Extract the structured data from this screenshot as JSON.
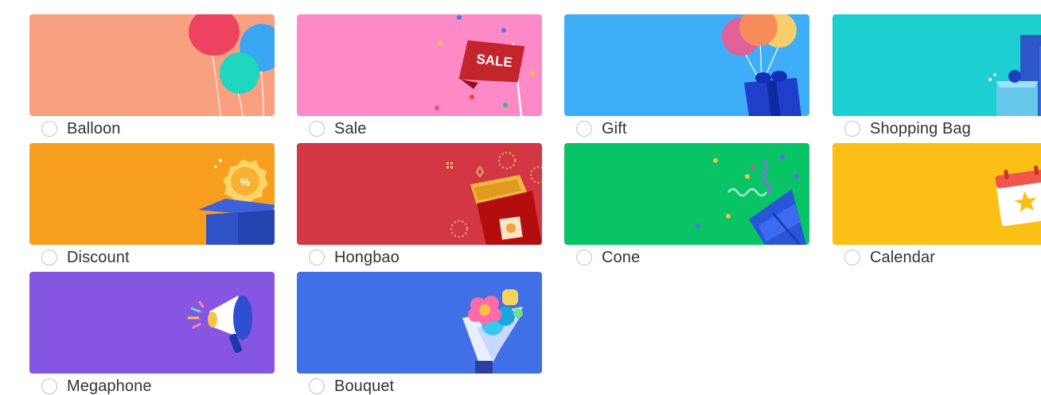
{
  "themes": [
    {
      "id": "balloon",
      "label": "Balloon",
      "color": "#f9a080",
      "icon": "balloon-icon",
      "selected": false
    },
    {
      "id": "sale",
      "label": "Sale",
      "color": "#fd8ac7",
      "icon": "sale-flag-icon",
      "selected": false,
      "badge_text": "SALE"
    },
    {
      "id": "gift",
      "label": "Gift",
      "color": "#3faef8",
      "icon": "gift-icon",
      "selected": false
    },
    {
      "id": "shopping-bag",
      "label": "Shopping Bag",
      "color": "#1ecfd1",
      "icon": "shopping-bag-icon",
      "selected": false
    },
    {
      "id": "discount",
      "label": "Discount",
      "color": "#f89e1f",
      "icon": "discount-box-icon",
      "selected": false,
      "badge_text": "%"
    },
    {
      "id": "hongbao",
      "label": "Hongbao",
      "color": "#d33744",
      "icon": "hongbao-icon",
      "selected": false
    },
    {
      "id": "cone",
      "label": "Cone",
      "color": "#08c466",
      "icon": "party-cone-icon",
      "selected": false
    },
    {
      "id": "calendar",
      "label": "Calendar",
      "color": "#fbbf16",
      "icon": "calendar-icon",
      "selected": false
    },
    {
      "id": "megaphone",
      "label": "Megaphone",
      "color": "#8655e1",
      "icon": "megaphone-icon",
      "selected": false
    },
    {
      "id": "bouquet",
      "label": "Bouquet",
      "color": "#416fe6",
      "icon": "bouquet-icon",
      "selected": false
    }
  ]
}
